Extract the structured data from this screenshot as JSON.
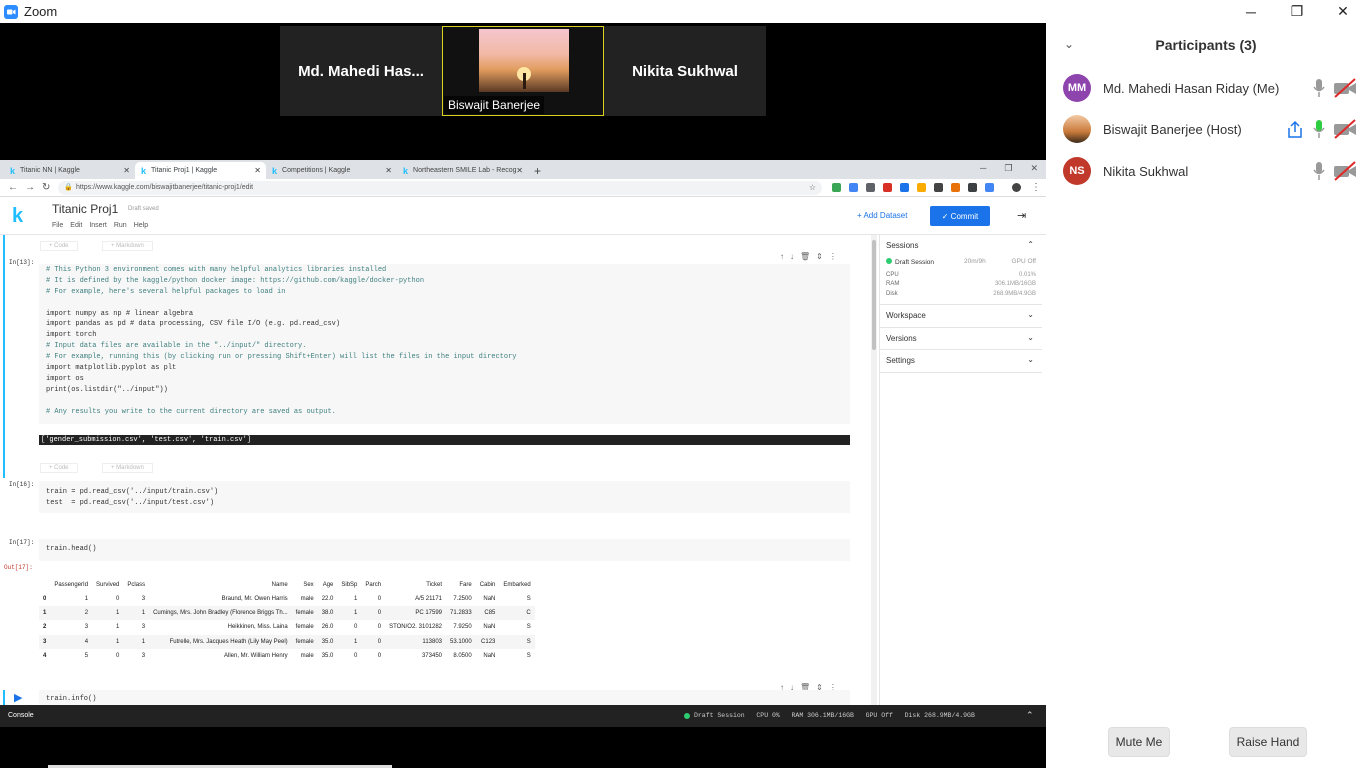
{
  "window": {
    "title": "Zoom",
    "minimize": "─",
    "maximize": "❐",
    "close": "✕"
  },
  "video": {
    "tiles": [
      {
        "name": "Md.  Mahedi  Has..."
      },
      {
        "name": "Biswajit Banerjee"
      },
      {
        "name": "Nikita Sukhwal"
      }
    ]
  },
  "browser": {
    "tabs": [
      {
        "title": "Titanic NN | Kaggle"
      },
      {
        "title": "Titanic Proj1 | Kaggle"
      },
      {
        "title": "Competitions | Kaggle"
      },
      {
        "title": "Northeastern SMILE Lab - Recog"
      }
    ],
    "url": "https://www.kaggle.com/biswajitbanerjee/titanic-proj1/edit"
  },
  "kaggle": {
    "logo": "k",
    "notebook_title": "Titanic Proj1",
    "draft_status": "Draft saved",
    "menu": [
      "File",
      "Edit",
      "Insert",
      "Run",
      "Help"
    ],
    "add_dataset": "+ Add Dataset",
    "commit": "✓ Commit",
    "add_code": "+ Code",
    "add_markdown": "+ Markdown"
  },
  "cells": {
    "c1_prompt": "In[13]:",
    "c1_lines": [
      "# This Python 3 environment comes with many helpful analytics libraries installed",
      "# It is defined by the kaggle/python docker image: https://github.com/kaggle/docker-python",
      "# For example, here's several helpful packages to load in",
      "",
      "import numpy as np # linear algebra",
      "import pandas as pd # data processing, CSV file I/O (e.g. pd.read_csv)",
      "import torch",
      "# Input data files are available in the \"../input/\" directory.",
      "# For example, running this (by clicking run or pressing Shift+Enter) will list the files in the input directory",
      "import matplotlib.pyplot as plt",
      "import os",
      "print(os.listdir(\"../input\"))",
      "",
      "# Any results you write to the current directory are saved as output."
    ],
    "c1_output": "['gender_submission.csv', 'test.csv', 'train.csv']",
    "c2_prompt": "In[16]:",
    "c2_lines": [
      "train = pd.read_csv('../input/train.csv')",
      "test  = pd.read_csv('../input/test.csv')"
    ],
    "c3_prompt": "In[17]:",
    "c3_line": "train.head()",
    "c3_out_prompt": "Out[17]:",
    "c4_line": "train.info()"
  },
  "table": {
    "columns": [
      "",
      "PassengerId",
      "Survived",
      "Pclass",
      "Name",
      "Sex",
      "Age",
      "SibSp",
      "Parch",
      "Ticket",
      "Fare",
      "Cabin",
      "Embarked"
    ],
    "rows": [
      [
        "0",
        "1",
        "0",
        "3",
        "Braund, Mr. Owen Harris",
        "male",
        "22.0",
        "1",
        "0",
        "A/5 21171",
        "7.2500",
        "NaN",
        "S"
      ],
      [
        "1",
        "2",
        "1",
        "1",
        "Cumings, Mrs. John Bradley (Florence Briggs Th...",
        "female",
        "38.0",
        "1",
        "0",
        "PC 17599",
        "71.2833",
        "C85",
        "C"
      ],
      [
        "2",
        "3",
        "1",
        "3",
        "Heikkinen, Miss. Laina",
        "female",
        "26.0",
        "0",
        "0",
        "STON/O2. 3101282",
        "7.9250",
        "NaN",
        "S"
      ],
      [
        "3",
        "4",
        "1",
        "1",
        "Futrelle, Mrs. Jacques Heath (Lily May Peel)",
        "female",
        "35.0",
        "1",
        "0",
        "113803",
        "53.1000",
        "C123",
        "S"
      ],
      [
        "4",
        "5",
        "0",
        "3",
        "Allen, Mr. William Henry",
        "male",
        "35.0",
        "0",
        "0",
        "373450",
        "8.0500",
        "NaN",
        "S"
      ]
    ]
  },
  "sidepanel": {
    "sessions": "Sessions",
    "draft_session": "Draft Session",
    "time": "20m/9h",
    "gpu": "GPU Off",
    "cpu_label": "CPU",
    "cpu_val": "0.01%",
    "ram_label": "RAM",
    "ram_val": "306.1MB/16GB",
    "disk_label": "Disk",
    "disk_val": "268.9MB/4.9GB",
    "workspace": "Workspace",
    "versions": "Versions",
    "settings": "Settings"
  },
  "statusbar": {
    "console": "Console",
    "info": "Draft Session   CPU 0%   RAM 306.1MB/16GB   GPU Off   Disk 268.9MB/4.9GB"
  },
  "participants": {
    "title": "Participants (3)",
    "list": [
      {
        "initials": "MM",
        "name": "Md. Mahedi Hasan Riday (Me)",
        "color": "#8e44ad"
      },
      {
        "initials": "",
        "name": "Biswajit Banerjee (Host)",
        "color": "#c97a3a"
      },
      {
        "initials": "NS",
        "name": "Nikita Sukhwal",
        "color": "#c0392b"
      }
    ],
    "mute_me": "Mute Me",
    "raise_hand": "Raise Hand"
  }
}
